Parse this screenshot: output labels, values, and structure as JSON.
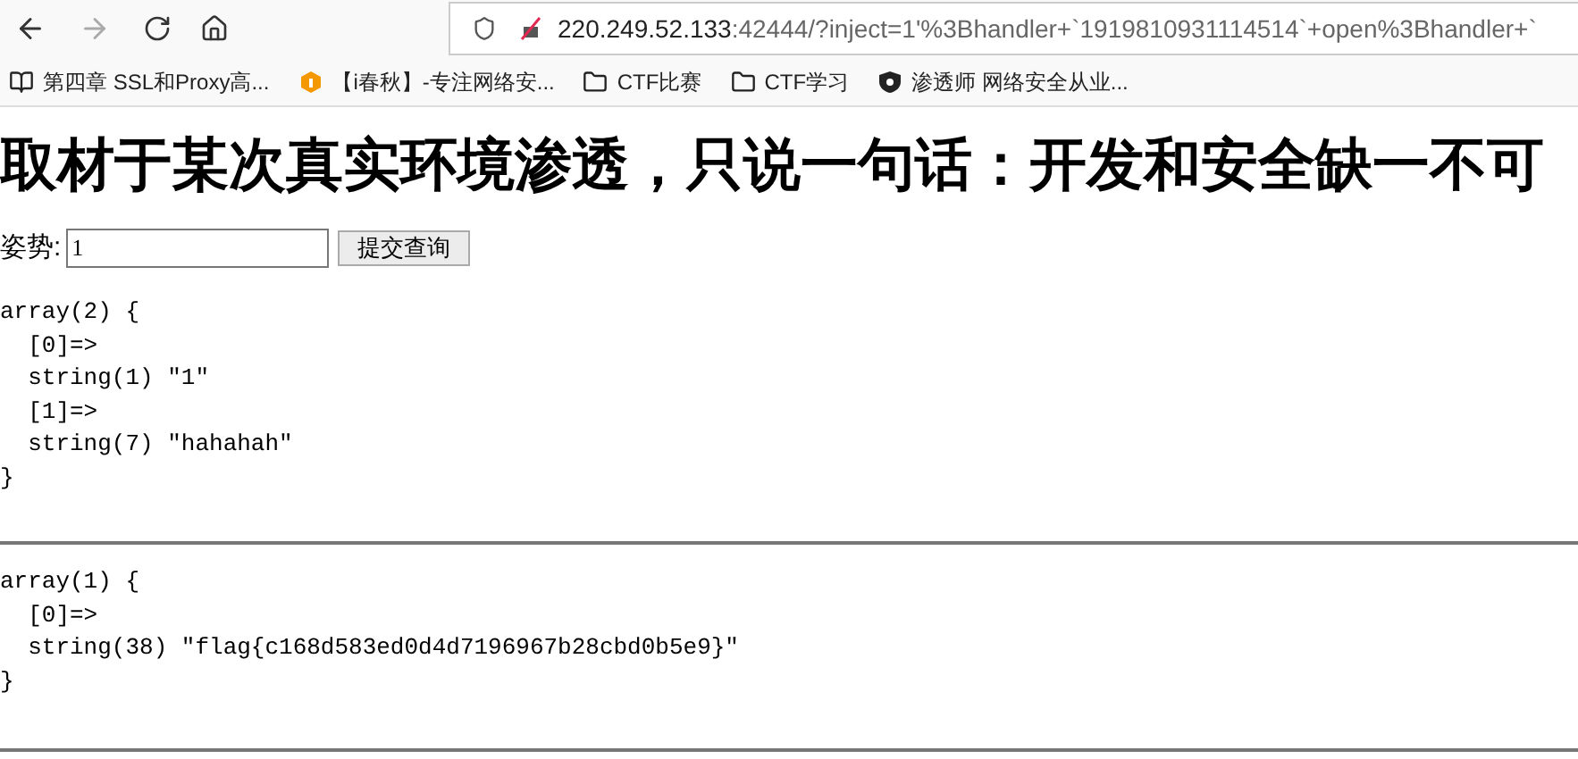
{
  "address_bar": {
    "host": "220.249.52.133",
    "rest": ":42444/?inject=1'%3Bhandler+`1919810931114514`+open%3Bhandler+`"
  },
  "bookmarks": [
    {
      "kind": "book",
      "label": "第四章 SSL和Proxy高..."
    },
    {
      "kind": "brand",
      "label": "【i春秋】-专注网络安..."
    },
    {
      "kind": "folder",
      "label": "CTF比赛"
    },
    {
      "kind": "folder",
      "label": "CTF学习"
    },
    {
      "kind": "shield",
      "label": "渗透师 网络安全从业..."
    }
  ],
  "heading": "取材于某次真实环境渗透，只说一句话：开发和安全缺一不可",
  "form": {
    "label": "姿势:",
    "value": "1",
    "button": "提交查询"
  },
  "dumps": [
    {
      "lines": [
        "array(2) {",
        "  [0]=>",
        "  string(1) \"1\"",
        "  [1]=>",
        "  string(7) \"hahahah\"",
        "}"
      ]
    },
    {
      "lines": [
        "array(1) {",
        "  [0]=>",
        "  string(38) \"flag{c168d583ed0d4d7196967b28cbd0b5e9}\"",
        "}"
      ]
    }
  ]
}
